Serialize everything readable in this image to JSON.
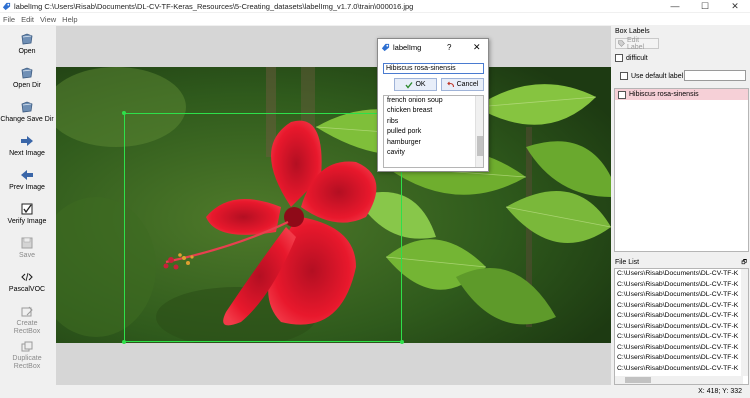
{
  "window": {
    "title": "labelImg C:\\Users\\Risab\\Documents\\DL-CV-TF-Keras_Resources\\5-Creating_datasets\\labelImg_v1.7.0\\train\\000016.jpg",
    "minimize": "—",
    "maximize": "☐",
    "close": "✕"
  },
  "menu": [
    "File",
    "Edit",
    "View",
    "Help"
  ],
  "toolbar": {
    "open": "Open",
    "open_dir": "Open Dir",
    "change_save_dir": "Change Save Dir",
    "next_image": "Next Image",
    "prev_image": "Prev Image",
    "verify_image": "Verify Image",
    "save": "Save",
    "format": "PascalVOC",
    "create_rectbox_1": "Create",
    "create_rectbox_2": "RectBox",
    "duplicate_rectbox_1": "Duplicate",
    "duplicate_rectbox_2": "RectBox"
  },
  "box_labels": {
    "title": "Box Labels",
    "edit_label": "Edit Label",
    "difficult": "difficult",
    "use_default_label": "Use default label",
    "default_label_value": "",
    "items": [
      "Hibiscus rosa-sinensis"
    ]
  },
  "file_list": {
    "title": "File List",
    "float_icon": "🗗",
    "items": [
      "C:\\Users\\Risab\\Documents\\DL-CV-TF-K",
      "C:\\Users\\Risab\\Documents\\DL-CV-TF-K",
      "C:\\Users\\Risab\\Documents\\DL-CV-TF-K",
      "C:\\Users\\Risab\\Documents\\DL-CV-TF-K",
      "C:\\Users\\Risab\\Documents\\DL-CV-TF-K",
      "C:\\Users\\Risab\\Documents\\DL-CV-TF-K",
      "C:\\Users\\Risab\\Documents\\DL-CV-TF-K",
      "C:\\Users\\Risab\\Documents\\DL-CV-TF-K",
      "C:\\Users\\Risab\\Documents\\DL-CV-TF-K",
      "C:\\Users\\Risab\\Documents\\DL-CV-TF-K"
    ]
  },
  "status": {
    "coords": "X: 418; Y: 332"
  },
  "dialog": {
    "title": "labelImg",
    "help": "?",
    "close": "✕",
    "input_value": "Hibiscus rosa-sinensis",
    "ok": "OK",
    "cancel": "Cancel",
    "items": [
      "french onion soup",
      "chicken breast",
      "ribs",
      "pulled pork",
      "hamburger",
      "cavity"
    ]
  },
  "colors": {
    "bbox": "#2ee04a",
    "selected_label": "#f6d0d7",
    "accent": "#2d6fd1"
  },
  "icons": [
    "open-folder-icon",
    "open-dir-icon",
    "save-dir-icon",
    "next-arrow-icon",
    "prev-arrow-icon",
    "verify-checkbox-icon",
    "save-disk-icon",
    "code-format-icon",
    "create-rectbox-icon",
    "duplicate-rectbox-icon",
    "tag-icon"
  ]
}
